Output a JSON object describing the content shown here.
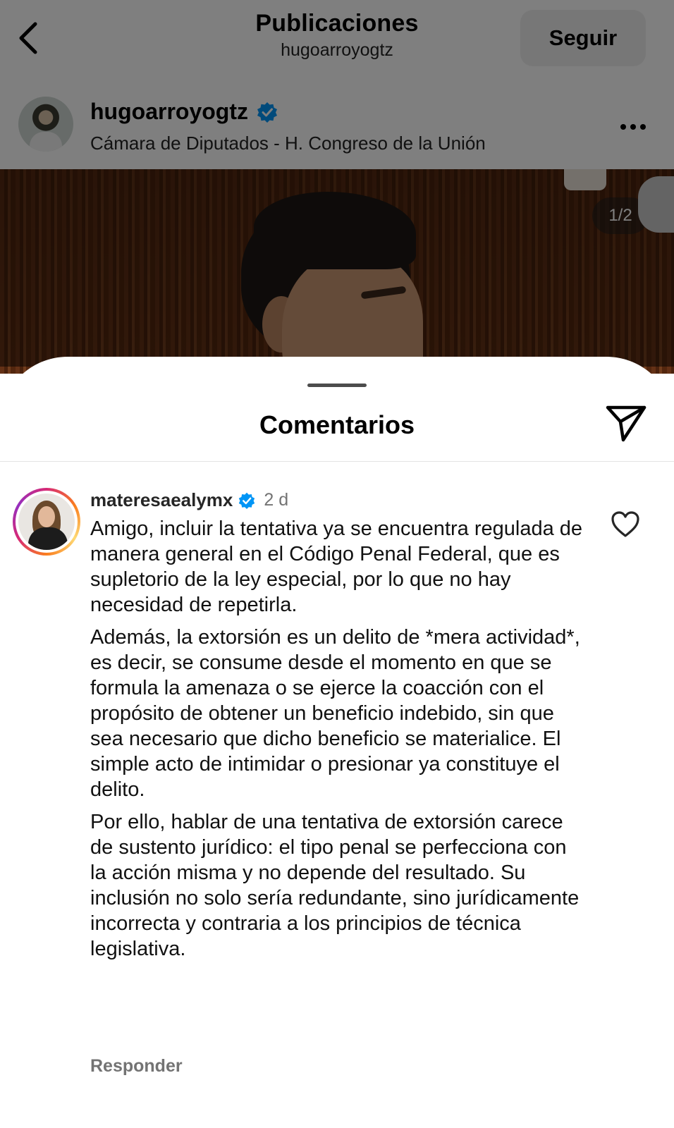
{
  "header": {
    "title": "Publicaciones",
    "subtitle": "hugoarroyogtz",
    "follow_label": "Seguir"
  },
  "post": {
    "username": "hugoarroyogtz",
    "verified": true,
    "location": "Cámara de Diputados - H. Congreso de la Unión",
    "image_counter": "1/2"
  },
  "comments_sheet": {
    "title": "Comentarios",
    "comment": {
      "username": "materesaealymx",
      "verified": true,
      "time": "2 d",
      "paragraphs": [
        "Amigo, incluir la tentativa ya se encuentra regulada de manera general en el Código Penal Federal, que es supletorio de la ley especial, por lo que no hay necesidad de repetirla.",
        "Además, la extorsión es un delito de *mera actividad*, es decir, se consume desde el momento en que se formula la amenaza o se ejerce la coacción con el propósito de obtener un beneficio indebido, sin que sea necesario que dicho beneficio se materialice. El simple acto de intimidar o presionar ya constituye el delito.",
        "Por ello, hablar de una tentativa de extorsión carece de sustento jurídico: el tipo penal se perfecciona con la acción misma y no depende del resultado. Su inclusión no solo sería redundante, sino jurídicamente incorrecta y contraria a los principios de técnica legislativa."
      ],
      "reply_label": "Responder"
    }
  },
  "colors": {
    "verified_badge": "#0095f6",
    "secondary_text": "#737373",
    "follow_button_bg": "#efefef"
  },
  "icons": [
    "back-chevron-icon",
    "verified-badge-icon",
    "more-options-icon",
    "share-send-icon",
    "heart-icon"
  ]
}
